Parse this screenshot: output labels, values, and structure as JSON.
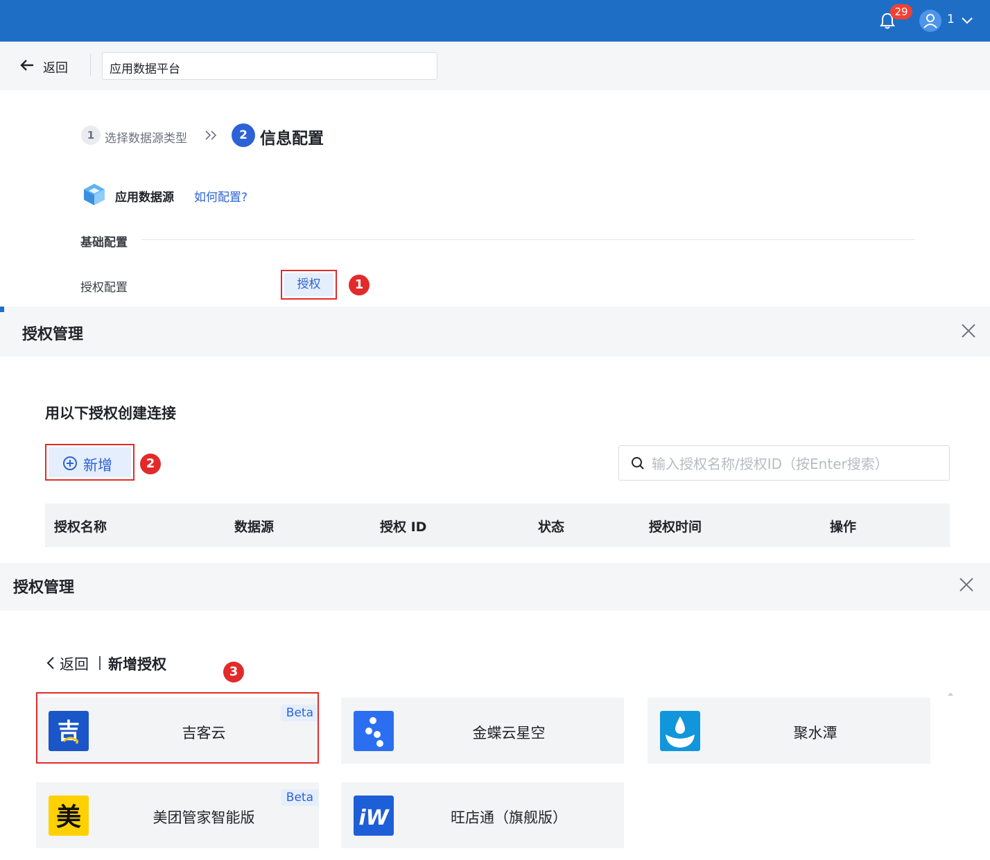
{
  "topbar": {
    "notification_count": "29",
    "user_name": "1",
    "icons": [
      "bell-icon",
      "user-icon",
      "chevron-down-icon"
    ],
    "color": "#1f6ec6"
  },
  "header": {
    "back_label": "返回",
    "platform_value": "应用数据平台"
  },
  "steps": [
    {
      "number": "1",
      "label": "选择数据源类型"
    },
    {
      "number": "2",
      "label": "信息配置"
    }
  ],
  "datasource": {
    "label": "应用数据源",
    "howto": "如何配置?"
  },
  "basic": {
    "section_label": "基础配置",
    "auth_row_label": "授权配置",
    "auth_button": "授权"
  },
  "markers": [
    "1",
    "2",
    "3"
  ],
  "dialog1": {
    "title": "授权管理",
    "subtitle": "用以下授权创建连接",
    "add_label": "新增",
    "search_placeholder": "输入授权名称/授权ID（按Enter搜索）",
    "columns": [
      "授权名称",
      "数据源",
      "授权 ID",
      "状态",
      "授权时间",
      "操作"
    ]
  },
  "dialog2": {
    "title": "授权管理",
    "back_label": "返回",
    "subtitle": "新增授权",
    "cards": [
      {
        "name": "吉客云",
        "badge": "Beta",
        "logo_text": "吉",
        "logo_color": "#1a56c8"
      },
      {
        "name": "金蝶云星空",
        "badge": "",
        "logo_text": "",
        "logo_color": "#2b6ff0"
      },
      {
        "name": "聚水潭",
        "badge": "",
        "logo_text": "",
        "logo_color": "#1296db"
      },
      {
        "name": "美团管家智能版",
        "badge": "Beta",
        "logo_text": "美",
        "logo_color": "#ffd100"
      },
      {
        "name": "旺店通（旗舰版）",
        "badge": "",
        "logo_text": "iW",
        "logo_color": "#1d5fd6"
      }
    ]
  },
  "colors": {
    "accent": "#2d62d6",
    "highlight": "#e32a2a"
  }
}
